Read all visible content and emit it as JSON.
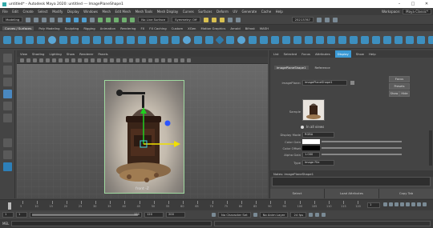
{
  "window": {
    "title": "untitled* - Autodesk Maya 2020: untitled   ---   ImagePlaneShape1"
  },
  "menubar": {
    "items": [
      "File",
      "Edit",
      "Create",
      "Select",
      "Modify",
      "Display",
      "Windows",
      "Mesh",
      "Edit Mesh",
      "Mesh Tools",
      "Mesh Display",
      "Curves",
      "Surfaces",
      "Deform",
      "UV",
      "Generate",
      "Cache",
      "Help"
    ],
    "workspace_label": "Workspace:",
    "workspace_value": "Maya Classic*"
  },
  "statusline": {
    "mode": "Modeling",
    "live_surface": "No Live Surface",
    "symmetry": "Symmetry: Off",
    "user_id": "25213787"
  },
  "shelf_tabs": [
    "Curves / Surfaces",
    "Poly Modeling",
    "Sculpting",
    "Rigging",
    "Animation",
    "Rendering",
    "FX",
    "FX Caching",
    "Custom",
    "XGen",
    "Motion Graphics",
    "Arnold",
    "Bifrost",
    "MASH"
  ],
  "viewport": {
    "menu": [
      "View",
      "Shading",
      "Lighting",
      "Show",
      "Renderer",
      "Panels"
    ],
    "camera_label": "front -Z"
  },
  "attribute_editor": {
    "tabs": [
      "List",
      "Selected",
      "Focus",
      "Attributes",
      "Display",
      "Show",
      "Help"
    ],
    "node_tabs": [
      "imagePlaneShape1",
      "Reference"
    ],
    "node_label": "imagePlane:",
    "node_value": "imagePlaneShape1",
    "focus_btn": "Focus",
    "presets_btn": "Presets",
    "show_btn": "Show",
    "hide_btn": "Hide",
    "sample_label": "Sample",
    "in_all_views": "In all views",
    "display_mode_label": "Display Mode",
    "display_mode_value": "RGBA",
    "color_gain_label": "Color Gain",
    "color_offset_label": "Color Offset",
    "alpha_gain_label": "Alpha Gain",
    "alpha_gain_value": "1.000",
    "type_label": "Type",
    "type_value": "Image File",
    "notes_label": "Notes: imagePlaneShape1",
    "select_btn": "Select",
    "load_attr_btn": "Load Attributes",
    "copy_tab_btn": "Copy Tab"
  },
  "timeslider": {
    "ticks": [
      "5",
      "10",
      "15",
      "20",
      "25",
      "30",
      "35",
      "40",
      "45",
      "50",
      "55",
      "60",
      "65",
      "70",
      "75",
      "80",
      "85",
      "90",
      "95",
      "100",
      "105",
      "110",
      "115",
      "120"
    ],
    "current_frame": "1"
  },
  "range": {
    "start": "1",
    "inner_start": "1",
    "inner_end": "120",
    "end_outer": "120",
    "end": "200",
    "character_set": "No Character Set",
    "anim_layer": "No Anim Layer",
    "fps": "24 fps"
  },
  "cmdline": {
    "lang": "MEL"
  },
  "colors": {
    "accent": "#3b9ad6",
    "select_green": "#9fd99f",
    "manip_y": "#f0e000",
    "manip_x": "#2b54ff",
    "manip_z": "#20d020"
  }
}
